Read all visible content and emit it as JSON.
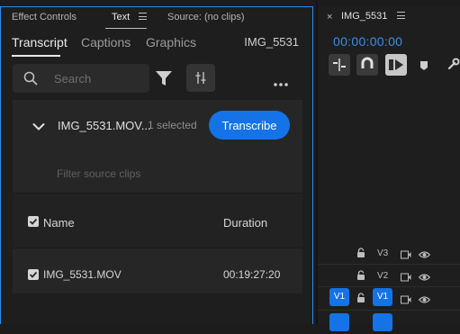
{
  "panel_tabs": {
    "effect_controls": "Effect Controls",
    "text": "Text",
    "source": "Source: (no clips)"
  },
  "subtabs": {
    "transcript": "Transcript",
    "captions": "Captions",
    "graphics": "Graphics",
    "clip_name": "IMG_5531"
  },
  "search": {
    "placeholder": "Search",
    "value": ""
  },
  "clip_row": {
    "title": "IMG_5531.MOV...",
    "selected": "1 selected",
    "transcribe_label": "Transcribe"
  },
  "filter": {
    "placeholder": "Filter source clips"
  },
  "table": {
    "columns": {
      "name": "Name",
      "duration": "Duration"
    },
    "rows": [
      {
        "name": "IMG_5531.MOV",
        "duration": "00:19:27:20",
        "checked": true
      }
    ]
  },
  "sequence": {
    "close": "×",
    "title": "IMG_5531",
    "timecode": "00:00:00:00",
    "tracks": [
      {
        "label": "V3"
      },
      {
        "label": "V2"
      },
      {
        "label": "V1",
        "source": "V1"
      }
    ]
  },
  "colors": {
    "accent": "#1473e6",
    "focus_border": "#2d8ceb",
    "timecode": "#3a8ff0"
  },
  "icons": [
    "search-icon",
    "filter-icon",
    "sliders-icon",
    "more-icon",
    "chevron-down-icon",
    "lock-icon",
    "eye-icon",
    "film-icon",
    "wrench-icon",
    "marker-icon",
    "magnet-icon"
  ]
}
